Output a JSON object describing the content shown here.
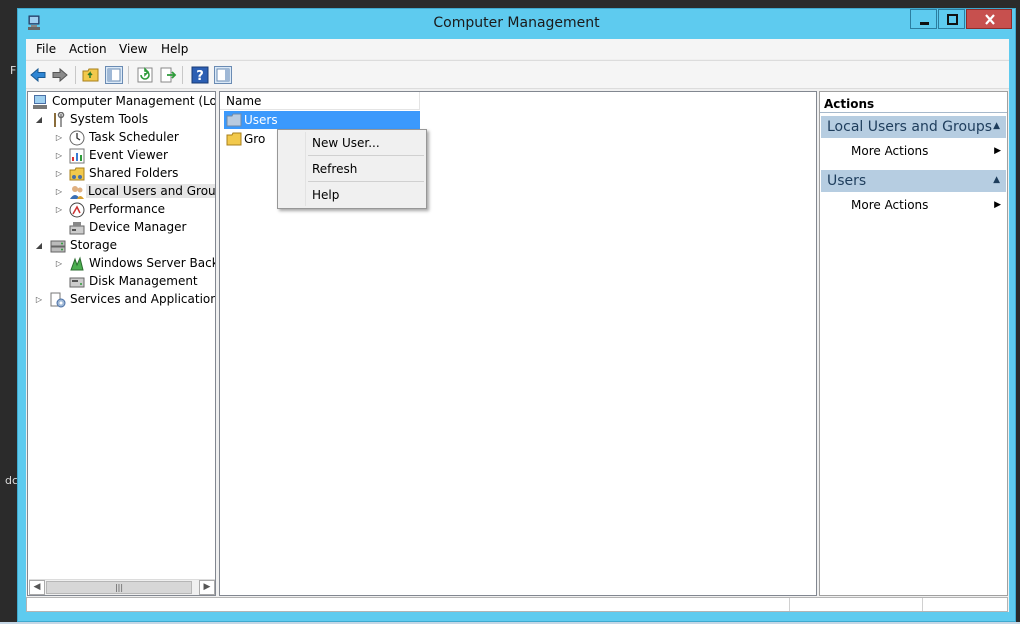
{
  "edge": {
    "glyph_top": "F",
    "glyph_mid": "dc"
  },
  "window": {
    "title": "Computer Management"
  },
  "menu": [
    "File",
    "Action",
    "View",
    "Help"
  ],
  "toolbar_icons": [
    "back-arrow-icon",
    "forward-arrow-icon",
    "up-folder-icon",
    "show-hide-console-tree-icon",
    "refresh-icon",
    "export-list-icon",
    "help-icon",
    "show-hide-action-pane-icon"
  ],
  "tree": {
    "root": "Computer Management (Local",
    "system_tools": "System Tools",
    "task_scheduler": "Task Scheduler",
    "event_viewer": "Event Viewer",
    "shared_folders": "Shared Folders",
    "local_users": "Local Users and Groups",
    "performance": "Performance",
    "device_manager": "Device Manager",
    "storage": "Storage",
    "wsb": "Windows Server Backup",
    "disk_mgmt": "Disk Management",
    "services": "Services and Applications"
  },
  "list": {
    "column_name": "Name",
    "row_users": "Users",
    "row_groups": "Gro"
  },
  "actions": {
    "title": "Actions",
    "group1": "Local Users and Groups",
    "group1_more": "More Actions",
    "group2": "Users",
    "group2_more": "More Actions"
  },
  "context_menu": [
    "New User...",
    "Refresh",
    "Help"
  ],
  "colors": {
    "titlebar": "#5ecbef",
    "selection": "#3b99fc",
    "action_header": "#b6cde1",
    "close_button": "#c7504e"
  }
}
